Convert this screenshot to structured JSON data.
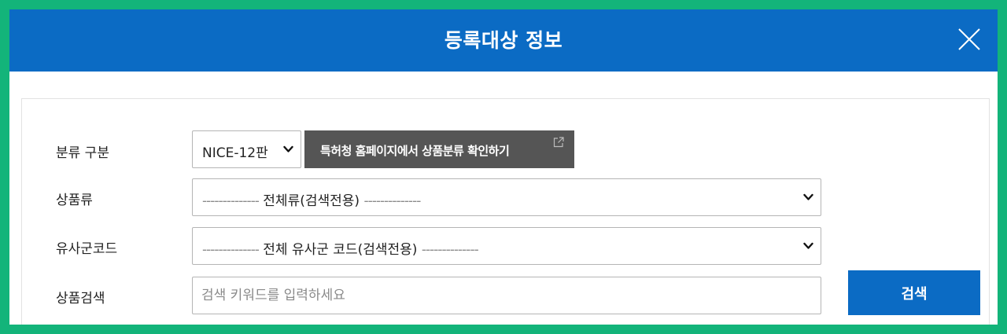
{
  "dialog": {
    "title": "등록대상 정보",
    "close_icon": "close-icon"
  },
  "form": {
    "classification": {
      "label": "분류 구분",
      "selected": "NICE-12판",
      "kipo_button_label": "특허청 홈페이지에서 상품분류 확인하기",
      "kipo_button_icon": "external-link-icon"
    },
    "product_class": {
      "label": "상품류",
      "dashes_left": "--------------",
      "selected": "전체류(검색전용)",
      "dashes_right": "--------------"
    },
    "similar_group": {
      "label": "유사군코드",
      "dashes_left": "--------------",
      "selected": "전체 유사군 코드(검색전용)",
      "dashes_right": "--------------"
    },
    "product_search": {
      "label": "상품검색",
      "placeholder": "검색 키워드를 입력하세요",
      "value": "",
      "button_label": "검색"
    }
  },
  "colors": {
    "outer_border": "#13b47a",
    "header_bg": "#0b6bc4",
    "primary_button": "#0b6bc4",
    "dark_button": "#555555"
  }
}
